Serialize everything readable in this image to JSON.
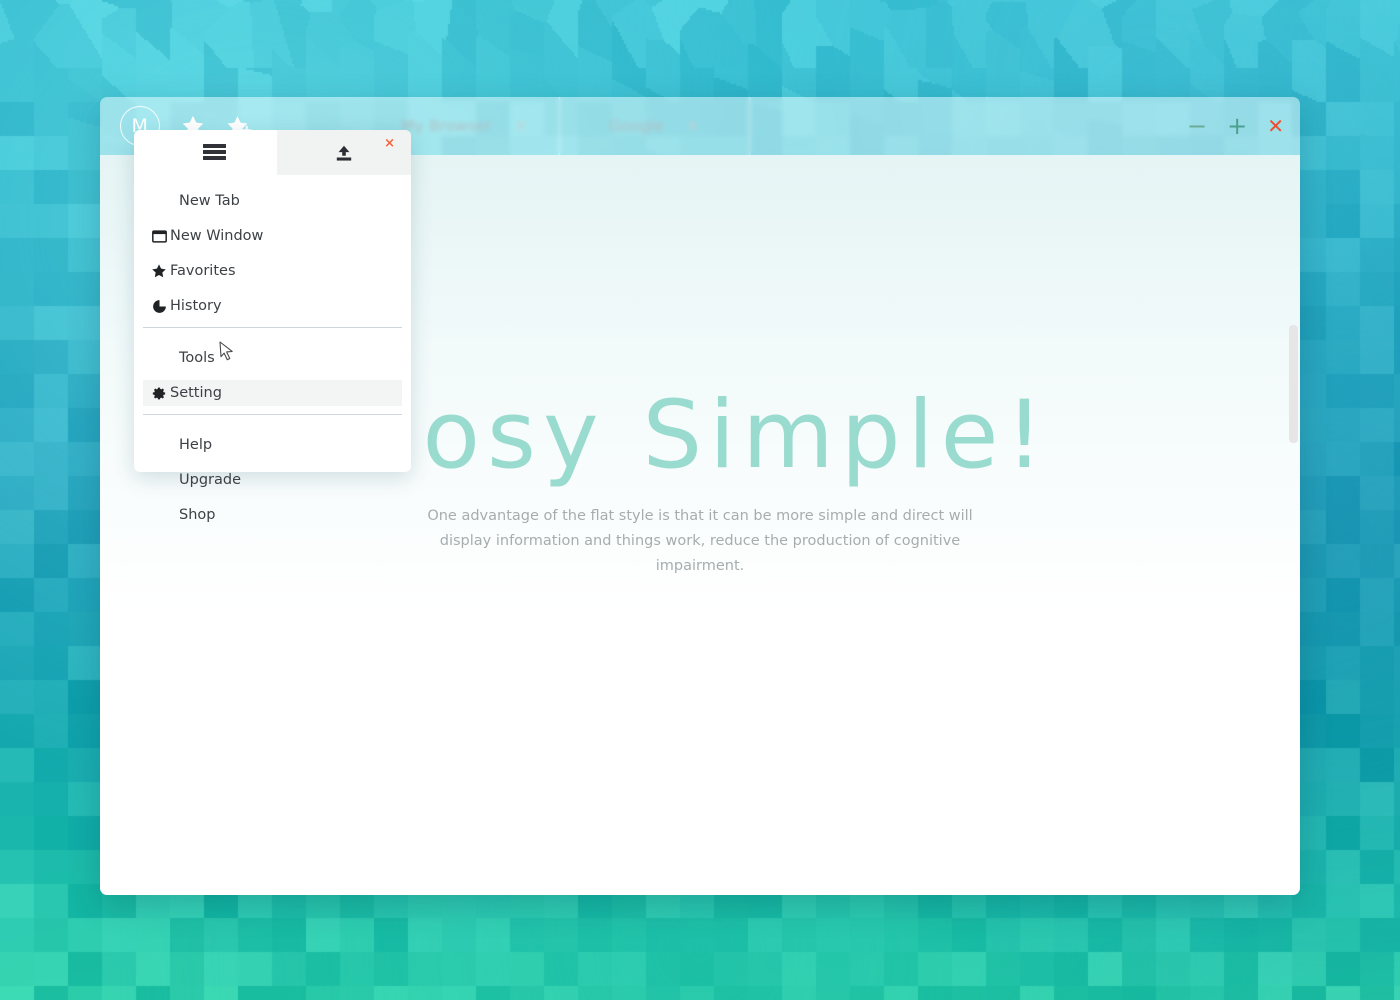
{
  "desktop": {
    "background_colors": [
      "#3ec6d8",
      "#2bb6c9",
      "#1f9fbb",
      "#24c4b0",
      "#2ecfa9"
    ],
    "pattern": "crystallize-mosaic"
  },
  "browser": {
    "logo": {
      "letter": "M",
      "name": "logo-m"
    },
    "quick_icons": [
      {
        "name": "star-icon",
        "glyph": "star"
      },
      {
        "name": "star-plus-icon",
        "glyph": "star-plus"
      }
    ],
    "tabs": [
      {
        "title": "My Browser",
        "close": "×",
        "active": true
      },
      {
        "title": "Google",
        "close": "×",
        "active": false
      }
    ],
    "window_controls": {
      "minimize": "−",
      "maximize": "+",
      "close": "✕",
      "minimize_color": "#6aab9a",
      "maximize_color": "#4aa08d",
      "close_color": "#ee4f2e"
    },
    "toolbar2": {
      "menu_button": "hamburger-icon",
      "upload_button": "upload-icon",
      "mini_close": "×"
    }
  },
  "menu": {
    "groups": [
      {
        "items": [
          {
            "label": "New Tab",
            "icon": null,
            "active": false
          },
          {
            "label": "New Window",
            "icon": "window-icon",
            "active": false
          },
          {
            "label": "Favorites",
            "icon": "star-icon",
            "active": false
          },
          {
            "label": "History",
            "icon": "pie-clock-icon",
            "active": false
          }
        ]
      },
      {
        "items": [
          {
            "label": "Tools",
            "icon": null,
            "active": false
          },
          {
            "label": "Setting",
            "icon": "gear-icon",
            "active": true
          }
        ]
      },
      {
        "items": [
          {
            "label": "Help",
            "icon": null,
            "active": false
          },
          {
            "label": "Upgrade",
            "icon": null,
            "active": false
          },
          {
            "label": "Shop",
            "icon": null,
            "active": false
          }
        ]
      }
    ],
    "highlight_color": "#f3f4f4"
  },
  "page": {
    "title": "Cosy Simple!",
    "title_color": "#9adbd0",
    "subtitle": "One advantage of the flat style is that it can be more simple and direct will display information and things work, reduce the production of cognitive impairment."
  },
  "scrollbar": {
    "thumb_color": "#e6e6e6"
  }
}
